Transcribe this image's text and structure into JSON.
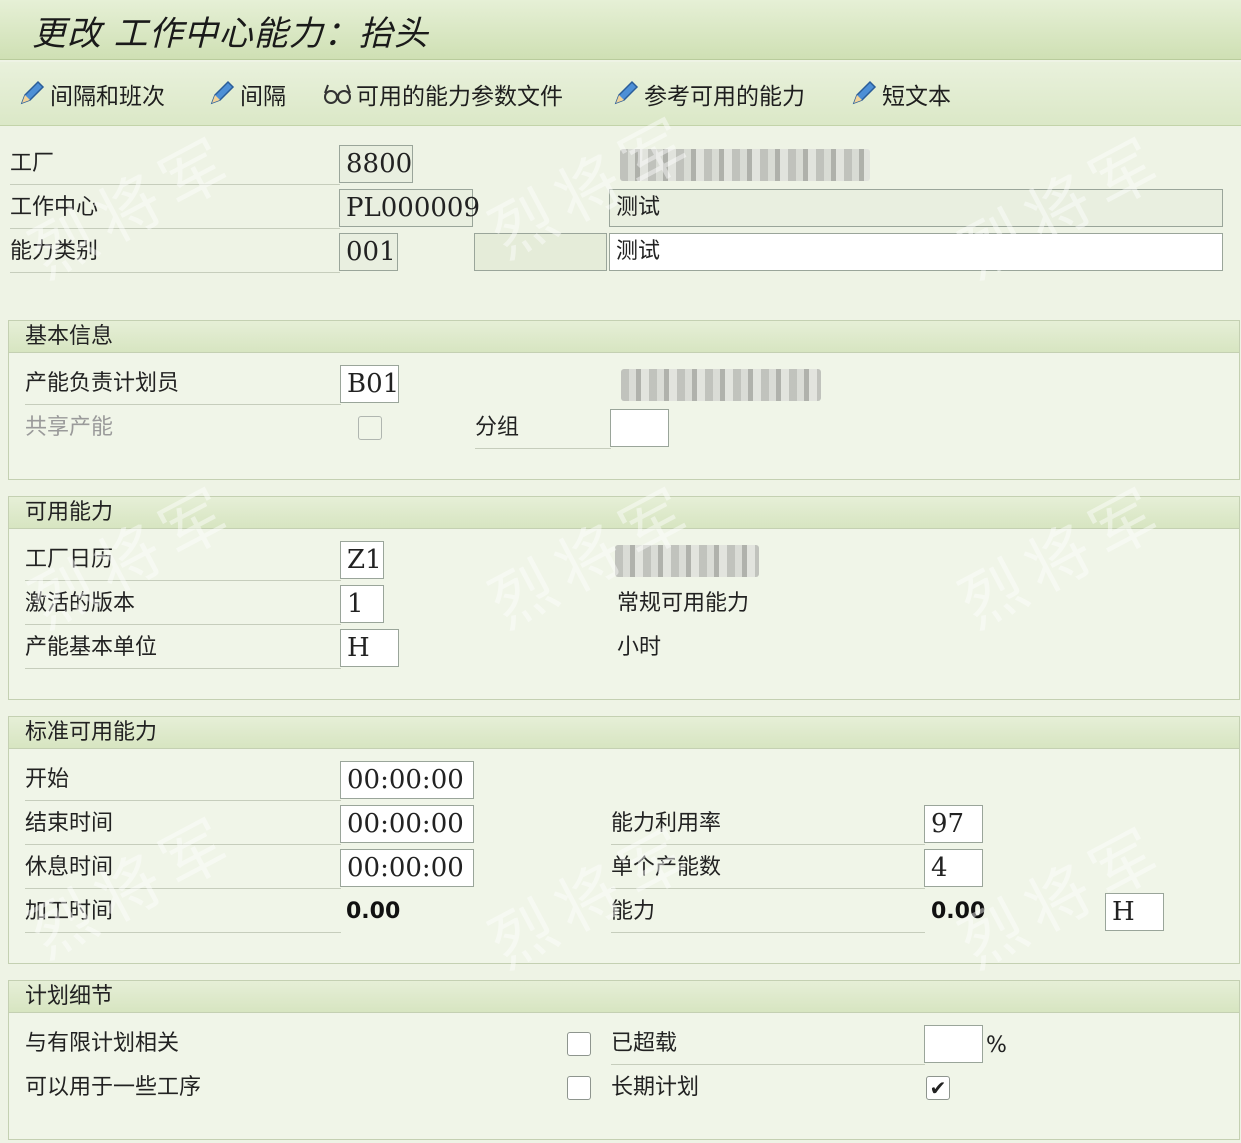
{
  "window": {
    "title": "更改 工作中心能力：抬头"
  },
  "toolbar": {
    "items": [
      {
        "label": "间隔和班次",
        "icon": "pencil-icon"
      },
      {
        "label": "间隔",
        "icon": "pencil-icon"
      },
      {
        "label": "可用的能力参数文件",
        "icon": "glasses-icon"
      },
      {
        "label": "参考可用的能力",
        "icon": "pencil-icon"
      },
      {
        "label": "短文本",
        "icon": "pencil-icon"
      }
    ]
  },
  "header": {
    "plant_label": "工厂",
    "plant_value": "8800",
    "workcenter_label": "工作中心",
    "workcenter_value": "PL000009",
    "workcenter_desc": "测试",
    "captype_label": "能力类别",
    "captype_value": "001",
    "captype_desc": "测试"
  },
  "basic": {
    "title": "基本信息",
    "planner_label": "产能负责计划员",
    "planner_value": "B01",
    "shared_label": "共享产能",
    "group_label": "分组",
    "group_value": ""
  },
  "available": {
    "title": "可用能力",
    "calendar_label": "工厂日历",
    "calendar_value": "Z1",
    "version_label": "激活的版本",
    "version_value": "1",
    "version_desc": "常规可用能力",
    "unit_label": "产能基本单位",
    "unit_value": "H",
    "unit_desc": "小时"
  },
  "standard": {
    "title": "标准可用能力",
    "start_label": "开始",
    "start_value": "00:00:00",
    "end_label": "结束时间",
    "end_value": "00:00:00",
    "break_label": "休息时间",
    "break_value": "00:00:00",
    "proc_label": "加工时间",
    "proc_value": "0.00",
    "util_label": "能力利用率",
    "util_value": "97",
    "units_label": "单个产能数",
    "units_value": "4",
    "cap_label": "能力",
    "cap_value": "0.00",
    "cap_unit": "H"
  },
  "planning": {
    "title": "计划细节",
    "finite_label": "与有限计划相关",
    "finite_checked": false,
    "overload_label": "已超载",
    "overload_value": "",
    "overload_unit": "%",
    "ops_label": "可以用于一些工序",
    "ops_checked": false,
    "longterm_label": "长期计划",
    "longterm_checked": true
  },
  "watermark": {
    "text": "烈将军"
  },
  "colors": {
    "title_bg": "#cfe0b4",
    "page_bg": "#eef3e5",
    "group_head": "#d7e5c1"
  }
}
